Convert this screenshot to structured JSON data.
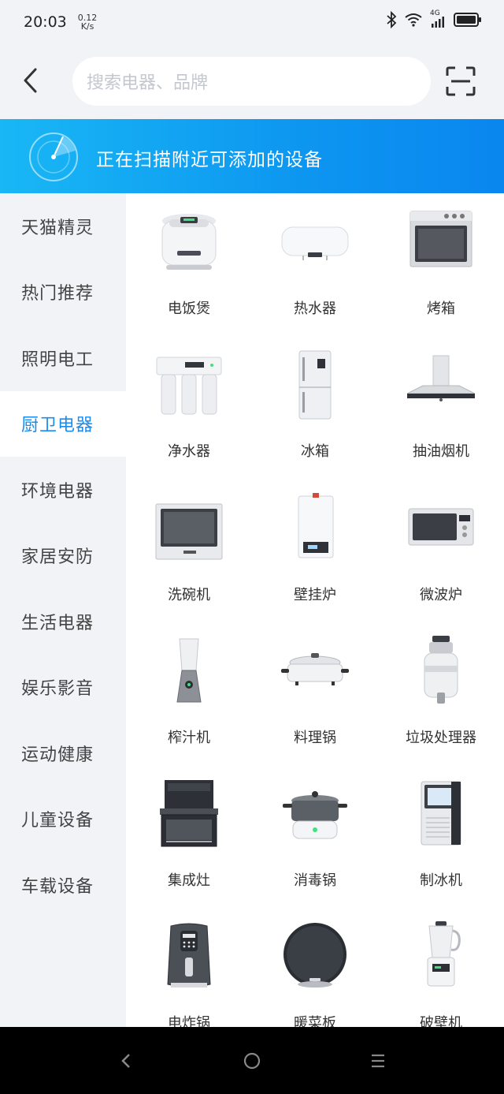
{
  "status_bar": {
    "time": "20:03",
    "speed_value": "0.12",
    "speed_unit": "K/s",
    "network": "4G"
  },
  "header": {
    "search_placeholder": "搜索电器、品牌"
  },
  "banner": {
    "text": "正在扫描附近可添加的设备"
  },
  "sidebar": {
    "items": [
      {
        "label": "天猫精灵",
        "active": false
      },
      {
        "label": "热门推荐",
        "active": false
      },
      {
        "label": "照明电工",
        "active": false
      },
      {
        "label": "厨卫电器",
        "active": true
      },
      {
        "label": "环境电器",
        "active": false
      },
      {
        "label": "家居安防",
        "active": false
      },
      {
        "label": "生活电器",
        "active": false
      },
      {
        "label": "娱乐影音",
        "active": false
      },
      {
        "label": "运动健康",
        "active": false
      },
      {
        "label": "儿童设备",
        "active": false
      },
      {
        "label": "车载设备",
        "active": false
      }
    ]
  },
  "devices": [
    {
      "label": "电饭煲",
      "icon": "rice-cooker-icon"
    },
    {
      "label": "热水器",
      "icon": "water-heater-icon"
    },
    {
      "label": "烤箱",
      "icon": "oven-icon"
    },
    {
      "label": "净水器",
      "icon": "water-purifier-icon"
    },
    {
      "label": "冰箱",
      "icon": "fridge-icon"
    },
    {
      "label": "抽油烟机",
      "icon": "range-hood-icon"
    },
    {
      "label": "洗碗机",
      "icon": "dishwasher-icon"
    },
    {
      "label": "壁挂炉",
      "icon": "wall-boiler-icon"
    },
    {
      "label": "微波炉",
      "icon": "microwave-icon"
    },
    {
      "label": "榨汁机",
      "icon": "juicer-icon"
    },
    {
      "label": "料理锅",
      "icon": "cooking-pot-icon"
    },
    {
      "label": "垃圾处理器",
      "icon": "garbage-disposer-icon"
    },
    {
      "label": "集成灶",
      "icon": "integrated-stove-icon"
    },
    {
      "label": "消毒锅",
      "icon": "sterilizer-pot-icon"
    },
    {
      "label": "制冰机",
      "icon": "ice-maker-icon"
    },
    {
      "label": "电炸锅",
      "icon": "air-fryer-icon"
    },
    {
      "label": "暖菜板",
      "icon": "warming-plate-icon"
    },
    {
      "label": "破壁机",
      "icon": "blender-icon"
    }
  ],
  "colors": {
    "accent": "#1a8cf0",
    "banner_start": "#19b7f5",
    "banner_end": "#0a86ef"
  }
}
